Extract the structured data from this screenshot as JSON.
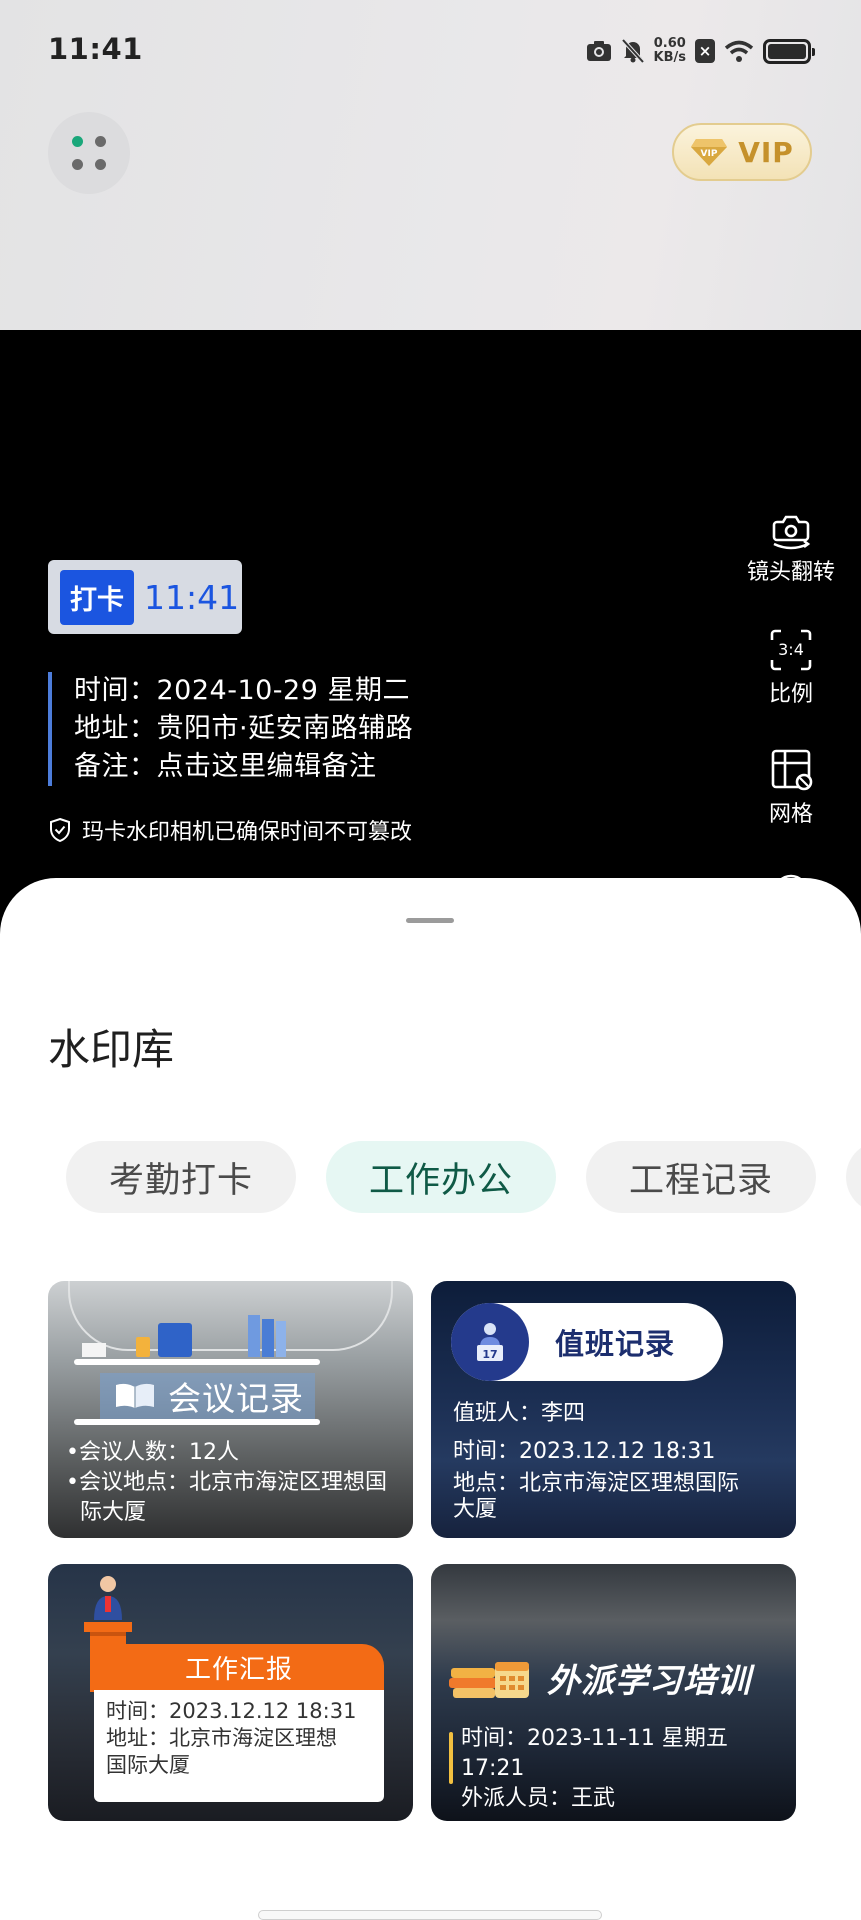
{
  "status_bar": {
    "time": "11:41",
    "speed_value": "0.60",
    "speed_unit": "KB/s"
  },
  "header": {
    "vip_label": "VIP"
  },
  "camera": {
    "punch_tag": "打卡",
    "punch_time": "11:41",
    "info_time": "时间：2024-10-29 星期二",
    "info_address": "地址：贵阳市·延安南路辅路",
    "info_note": "备注：点击这里编辑备注",
    "verify_note": "玛卡水印相机已确保时间不可篡改",
    "tools": [
      {
        "label": "镜头翻转",
        "icon": "camera-flip-icon"
      },
      {
        "label": "比例",
        "icon": "ratio-icon",
        "icon_text": "3:4"
      },
      {
        "label": "网格",
        "icon": "grid-icon"
      }
    ]
  },
  "sheet": {
    "title": "水印库",
    "tabs": [
      "考勤打卡",
      "工作办公",
      "工程记录"
    ],
    "active_tab": "工作办公",
    "cards": [
      {
        "title": "会议记录",
        "line1": "•会议人数：12人",
        "line2": "•会议地点：北京市海淀区理想国",
        "line3": "  际大厦"
      },
      {
        "title": "值班记录",
        "line1": "值班人：李四",
        "line2": "时间：2023.12.12 18:31",
        "line3": "地点：北京市海淀区理想国际",
        "line4": "大厦"
      },
      {
        "title": "工作汇报",
        "line1": "时间：2023.12.12 18:31",
        "line2": "地址：北京市海淀区理想",
        "line3": "国际大厦"
      },
      {
        "title": "外派学习培训",
        "line1": "时间：2023-11-11 星期五 17:21",
        "line2": "外派人员：王武"
      }
    ]
  },
  "colors": {
    "accent_green": "#0f5a46",
    "punch_blue": "#1b55e0",
    "vip_gold": "#c5912b",
    "report_orange": "#f36b15"
  }
}
